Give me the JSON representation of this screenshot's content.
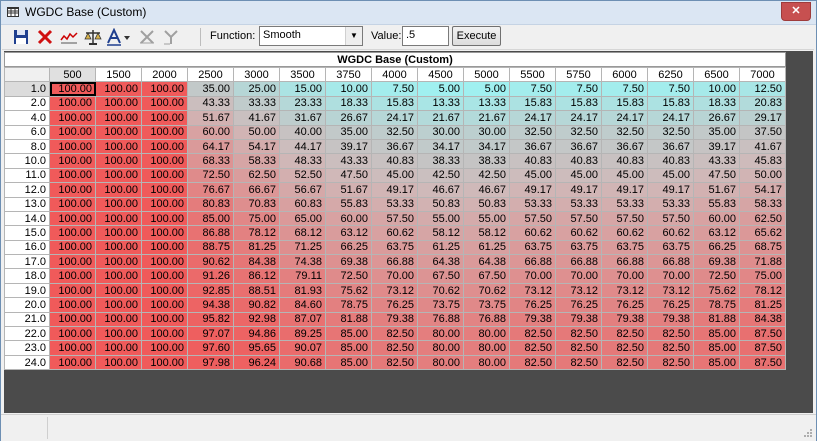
{
  "window": {
    "title": "WGDC Base (Custom)",
    "close_label": "✕"
  },
  "toolbar": {
    "icons": [
      "save-icon",
      "delete-icon",
      "graph-icon",
      "scale-icon",
      "text-format-icon",
      "interpolate-x-icon",
      "interpolate-y-icon"
    ],
    "function_label": "Function:",
    "function_value": "Smooth",
    "value_label": "Value:",
    "value_input": ".5",
    "execute_label": "Execute"
  },
  "table": {
    "title": "WGDC Base (Custom)",
    "columns": [
      "500",
      "1500",
      "2000",
      "2500",
      "3000",
      "3500",
      "3750",
      "4000",
      "4500",
      "5000",
      "5500",
      "5750",
      "6000",
      "6250",
      "6500",
      "7000"
    ],
    "rows": [
      {
        "label": "1.0",
        "values": [
          "100.00",
          "100.00",
          "100.00",
          "35.00",
          "25.00",
          "15.00",
          "10.00",
          "7.50",
          "5.00",
          "5.00",
          "7.50",
          "7.50",
          "7.50",
          "7.50",
          "10.00",
          "12.50"
        ]
      },
      {
        "label": "2.0",
        "values": [
          "100.00",
          "100.00",
          "100.00",
          "43.33",
          "33.33",
          "23.33",
          "18.33",
          "15.83",
          "13.33",
          "13.33",
          "15.83",
          "15.83",
          "15.83",
          "15.83",
          "18.33",
          "20.83"
        ]
      },
      {
        "label": "4.0",
        "values": [
          "100.00",
          "100.00",
          "100.00",
          "51.67",
          "41.67",
          "31.67",
          "26.67",
          "24.17",
          "21.67",
          "21.67",
          "24.17",
          "24.17",
          "24.17",
          "24.17",
          "26.67",
          "29.17"
        ]
      },
      {
        "label": "6.0",
        "values": [
          "100.00",
          "100.00",
          "100.00",
          "60.00",
          "50.00",
          "40.00",
          "35.00",
          "32.50",
          "30.00",
          "30.00",
          "32.50",
          "32.50",
          "32.50",
          "32.50",
          "35.00",
          "37.50"
        ]
      },
      {
        "label": "8.0",
        "values": [
          "100.00",
          "100.00",
          "100.00",
          "64.17",
          "54.17",
          "44.17",
          "39.17",
          "36.67",
          "34.17",
          "34.17",
          "36.67",
          "36.67",
          "36.67",
          "36.67",
          "39.17",
          "41.67"
        ]
      },
      {
        "label": "10.0",
        "values": [
          "100.00",
          "100.00",
          "100.00",
          "68.33",
          "58.33",
          "48.33",
          "43.33",
          "40.83",
          "38.33",
          "38.33",
          "40.83",
          "40.83",
          "40.83",
          "40.83",
          "43.33",
          "45.83"
        ]
      },
      {
        "label": "11.0",
        "values": [
          "100.00",
          "100.00",
          "100.00",
          "72.50",
          "62.50",
          "52.50",
          "47.50",
          "45.00",
          "42.50",
          "42.50",
          "45.00",
          "45.00",
          "45.00",
          "45.00",
          "47.50",
          "50.00"
        ]
      },
      {
        "label": "12.0",
        "values": [
          "100.00",
          "100.00",
          "100.00",
          "76.67",
          "66.67",
          "56.67",
          "51.67",
          "49.17",
          "46.67",
          "46.67",
          "49.17",
          "49.17",
          "49.17",
          "49.17",
          "51.67",
          "54.17"
        ]
      },
      {
        "label": "13.0",
        "values": [
          "100.00",
          "100.00",
          "100.00",
          "80.83",
          "70.83",
          "60.83",
          "55.83",
          "53.33",
          "50.83",
          "50.83",
          "53.33",
          "53.33",
          "53.33",
          "53.33",
          "55.83",
          "58.33"
        ]
      },
      {
        "label": "14.0",
        "values": [
          "100.00",
          "100.00",
          "100.00",
          "85.00",
          "75.00",
          "65.00",
          "60.00",
          "57.50",
          "55.00",
          "55.00",
          "57.50",
          "57.50",
          "57.50",
          "57.50",
          "60.00",
          "62.50"
        ]
      },
      {
        "label": "15.0",
        "values": [
          "100.00",
          "100.00",
          "100.00",
          "86.88",
          "78.12",
          "68.12",
          "63.12",
          "60.62",
          "58.12",
          "58.12",
          "60.62",
          "60.62",
          "60.62",
          "60.62",
          "63.12",
          "65.62"
        ]
      },
      {
        "label": "16.0",
        "values": [
          "100.00",
          "100.00",
          "100.00",
          "88.75",
          "81.25",
          "71.25",
          "66.25",
          "63.75",
          "61.25",
          "61.25",
          "63.75",
          "63.75",
          "63.75",
          "63.75",
          "66.25",
          "68.75"
        ]
      },
      {
        "label": "17.0",
        "values": [
          "100.00",
          "100.00",
          "100.00",
          "90.62",
          "84.38",
          "74.38",
          "69.38",
          "66.88",
          "64.38",
          "64.38",
          "66.88",
          "66.88",
          "66.88",
          "66.88",
          "69.38",
          "71.88"
        ]
      },
      {
        "label": "18.0",
        "values": [
          "100.00",
          "100.00",
          "100.00",
          "91.26",
          "86.12",
          "79.11",
          "72.50",
          "70.00",
          "67.50",
          "67.50",
          "70.00",
          "70.00",
          "70.00",
          "70.00",
          "72.50",
          "75.00"
        ]
      },
      {
        "label": "19.0",
        "values": [
          "100.00",
          "100.00",
          "100.00",
          "92.85",
          "88.51",
          "81.93",
          "75.62",
          "73.12",
          "70.62",
          "70.62",
          "73.12",
          "73.12",
          "73.12",
          "73.12",
          "75.62",
          "78.12"
        ]
      },
      {
        "label": "20.0",
        "values": [
          "100.00",
          "100.00",
          "100.00",
          "94.38",
          "90.82",
          "84.60",
          "78.75",
          "76.25",
          "73.75",
          "73.75",
          "76.25",
          "76.25",
          "76.25",
          "76.25",
          "78.75",
          "81.25"
        ]
      },
      {
        "label": "21.0",
        "values": [
          "100.00",
          "100.00",
          "100.00",
          "95.82",
          "92.98",
          "87.07",
          "81.88",
          "79.38",
          "76.88",
          "76.88",
          "79.38",
          "79.38",
          "79.38",
          "79.38",
          "81.88",
          "84.38"
        ]
      },
      {
        "label": "22.0",
        "values": [
          "100.00",
          "100.00",
          "100.00",
          "97.07",
          "94.86",
          "89.25",
          "85.00",
          "82.50",
          "80.00",
          "80.00",
          "82.50",
          "82.50",
          "82.50",
          "82.50",
          "85.00",
          "87.50"
        ]
      },
      {
        "label": "23.0",
        "values": [
          "100.00",
          "100.00",
          "100.00",
          "97.60",
          "95.65",
          "90.07",
          "85.00",
          "82.50",
          "80.00",
          "80.00",
          "82.50",
          "82.50",
          "82.50",
          "82.50",
          "85.00",
          "87.50"
        ]
      },
      {
        "label": "24.0",
        "values": [
          "100.00",
          "100.00",
          "100.00",
          "97.98",
          "96.24",
          "90.68",
          "85.00",
          "82.50",
          "80.00",
          "80.00",
          "82.50",
          "82.50",
          "82.50",
          "82.50",
          "85.00",
          "87.50"
        ]
      }
    ],
    "selected_column": 0,
    "selected_row": 0,
    "active_cell": [
      0,
      0
    ]
  },
  "colors": {
    "low": "#a0f0f0",
    "mid": "#d0b8b8",
    "high": "#f05a5a",
    "grid_bg": "#4b4b4b"
  }
}
